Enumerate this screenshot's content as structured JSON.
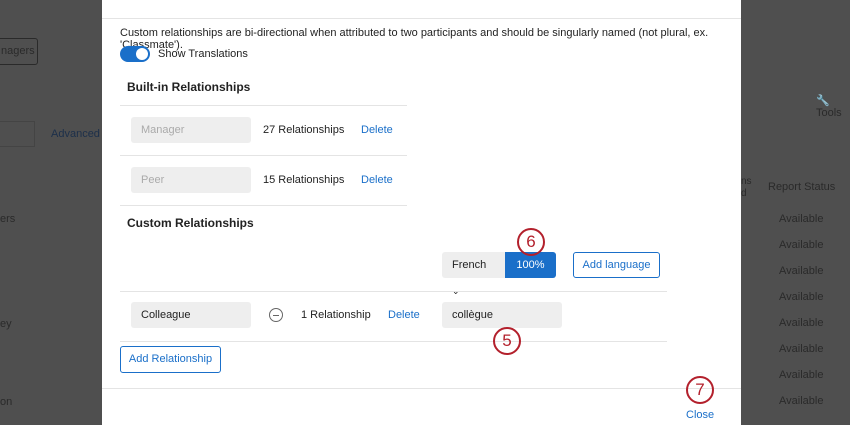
{
  "background": {
    "managers_button": "nagers",
    "advanced_search": "Advanced S",
    "tools": "Tools",
    "col_partial": "ns\nd",
    "report_status_header": "Report Status",
    "report_status_values": [
      "Available",
      "Available",
      "Available",
      "Available",
      "Available",
      "Available",
      "Available",
      "Available"
    ],
    "left_partials": [
      "ers",
      "ey",
      "on"
    ]
  },
  "modal": {
    "description": "Custom relationships are bi-directional when attributed to two participants and should be singularly named (not plural, ex. 'Classmate').",
    "toggle_label": "Show Translations",
    "builtin_heading": "Built-in Relationships",
    "builtin": [
      {
        "name": "Manager",
        "count": "27 Relationships",
        "delete": "Delete"
      },
      {
        "name": "Peer",
        "count": "15 Relationships",
        "delete": "Delete"
      }
    ],
    "custom_heading": "Custom Relationships",
    "language_select": "French",
    "translation_progress": "100%",
    "add_language": "Add language",
    "custom": [
      {
        "name": "Colleague",
        "count": "1 Relationship",
        "delete": "Delete",
        "translation": "collègue"
      }
    ],
    "add_relationship": "Add Relationship",
    "close": "Close"
  },
  "annotations": [
    "6",
    "5",
    "7"
  ],
  "colors": {
    "accent": "#1a6fc9",
    "annotation": "#b3202c",
    "overlay": "#4f4f4f"
  }
}
